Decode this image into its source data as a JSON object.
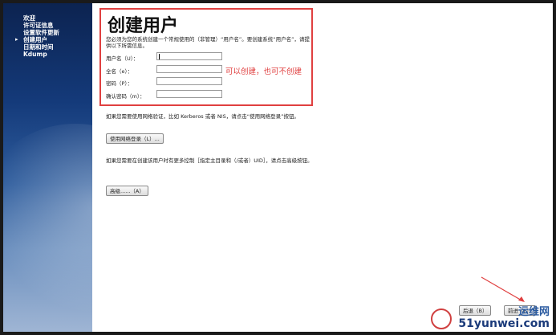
{
  "sidebar": {
    "items": [
      {
        "label": "欢迎",
        "current": false
      },
      {
        "label": "许可证信息",
        "current": false
      },
      {
        "label": "设置软件更新",
        "current": false
      },
      {
        "label": "创建用户",
        "current": true
      },
      {
        "label": "日期和时间",
        "current": false
      },
      {
        "label": "Kdump",
        "current": false
      }
    ],
    "current_marker": "▸"
  },
  "main": {
    "title": "创建用户",
    "description": "您必须为您的系统创建一个常规使用的（非管理）“用户名”。要创建系统“用户名”，请提供以下所需信息。",
    "fields": [
      {
        "label": "用户名（U）：",
        "value": ""
      },
      {
        "label": "全名（e）：",
        "value": ""
      },
      {
        "label": "密码（P）：",
        "value": ""
      },
      {
        "label": "确认密码（m）：",
        "value": ""
      }
    ],
    "annotation_note": "可以创建，也可不创建",
    "network_text": "如果您需要使用网络验证，比如 Kerberos 或者 NIS，请点击“使用网络登录”按钮。",
    "network_button": "使用网络登录（L）...",
    "advanced_text": "如果您需要在创建该用户时有更多控制［指定主目录和（/或者）UID］，请点击高级按钮。",
    "advanced_button": "高级......（A）"
  },
  "footer": {
    "back_button": "后退（B）",
    "forward_button": "前进（F）"
  },
  "watermark": {
    "line1": "运维网",
    "line2": "51yunwei.com"
  },
  "colors": {
    "annotation_red": "#e04040",
    "sidebar_top": "#0c2350",
    "sidebar_bottom": "#9fb5d4"
  }
}
